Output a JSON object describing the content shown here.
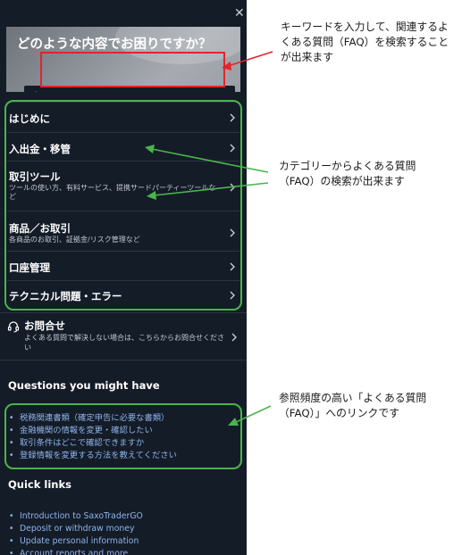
{
  "panel": {
    "hero_title": "どのような内容でお困りですか？",
    "search": {
      "value": "",
      "placeholder": ""
    },
    "categories": [
      {
        "title": "はじめに",
        "subtitle": ""
      },
      {
        "title": "入出金・移管",
        "subtitle": ""
      },
      {
        "title": "取引ツール",
        "subtitle": "ツールの使い方、有料サービス、提携サードパーティーツールなど"
      },
      {
        "title": "商品／お取引",
        "subtitle": "各商品のお取引、証拠金/リスク管理など"
      },
      {
        "title": "口座管理",
        "subtitle": ""
      },
      {
        "title": "テクニカル問題・エラー",
        "subtitle": ""
      }
    ],
    "contact": {
      "title": "お問合せ",
      "subtitle": "よくある質問で解決しない場合は、こちらからお問合せください"
    },
    "questions_heading": "Questions you might have",
    "questions": [
      "税務関連書類（確定申告に必要な書類）",
      "金融機関の情報を変更・確認したい",
      "取引条件はどこで確認できますか",
      "登録情報を変更する方法を教えてください"
    ],
    "quick_links_heading": "Quick links",
    "quick_links": [
      "Introduction to SaxoTraderGO",
      "Deposit or withdraw money",
      "Update personal information",
      "Account reports and more"
    ]
  },
  "annotations": {
    "search_note": "キーワードを入力して、関連するよくある質問（FAQ）を検索することが出来ます",
    "category_note": "カテゴリーからよくある質問（FAQ）の検索が出来ます",
    "links_note": "参照頻度の高い「よくある質問（FAQ）」へのリンクです"
  },
  "colors": {
    "panel_bg": "#141c28",
    "link": "#8fb3ea",
    "highlight_red": "#e3242b",
    "highlight_green": "#4ab54a"
  },
  "icons": {
    "close": "close-icon",
    "search": "search-icon",
    "contact": "headset-icon",
    "chevron": "chevron-right-icon"
  }
}
